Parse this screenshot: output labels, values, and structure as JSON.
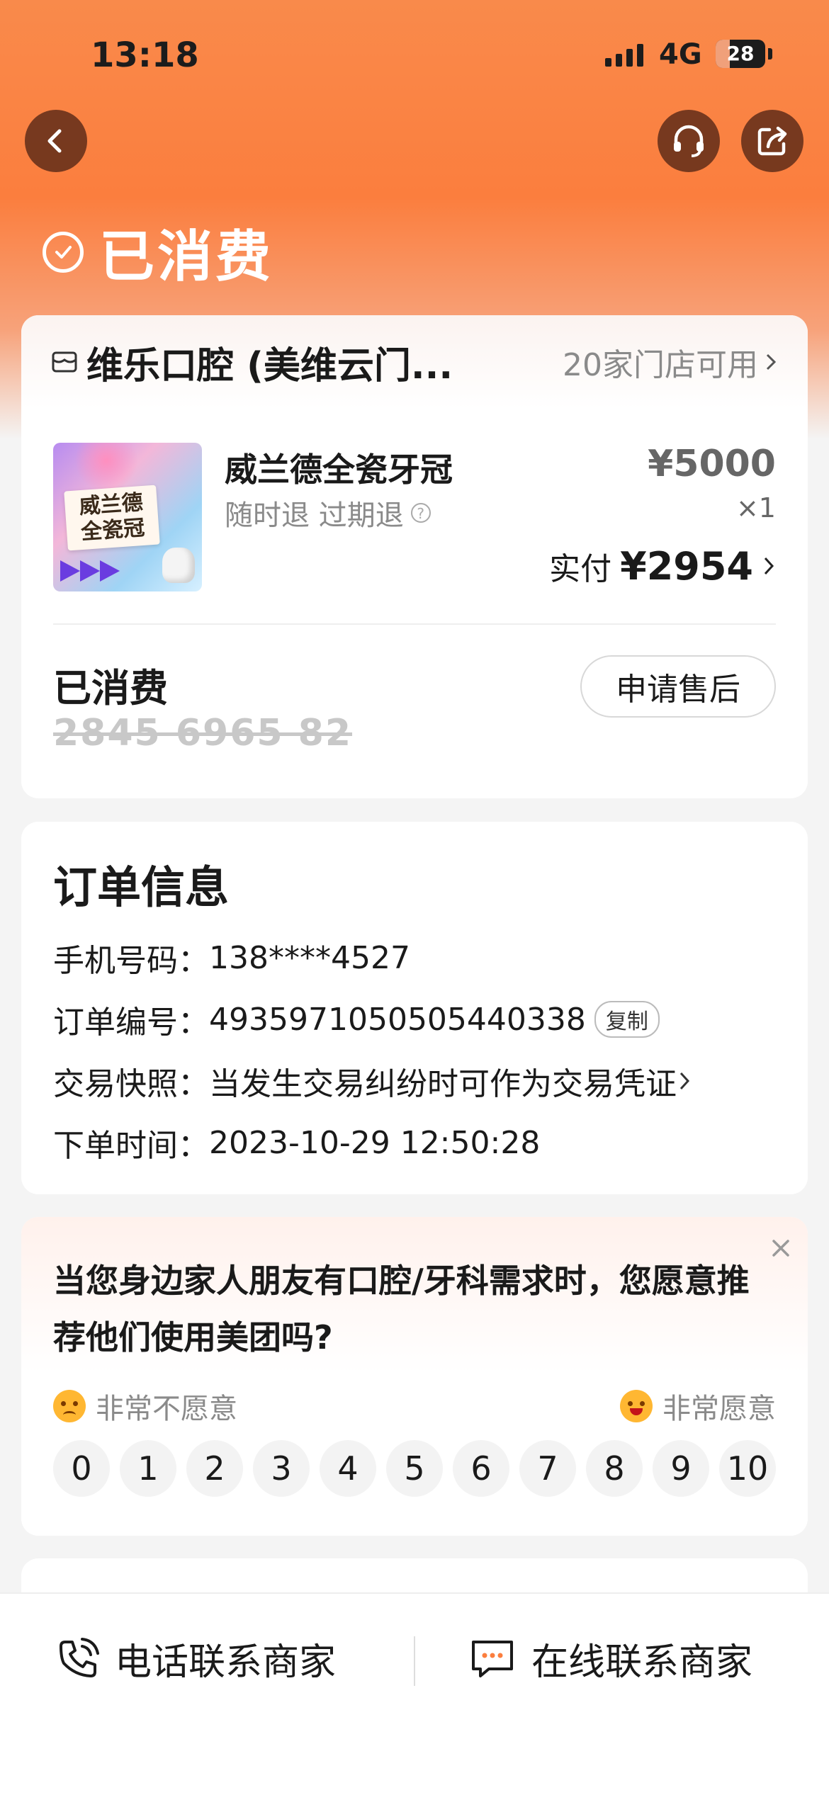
{
  "status_bar": {
    "time": "13:18",
    "network": "4G",
    "battery": "28",
    "battery_level": 0.28
  },
  "header": {
    "page_title": "已消费"
  },
  "order_card": {
    "shop_name": "维乐口腔 (美维云门...",
    "shop_availability": "20家门店可用",
    "product_image_text": [
      "威兰德",
      "全瓷冠"
    ],
    "product_name": "威兰德全瓷牙冠",
    "product_tags": "随时退 过期退",
    "original_price": "¥5000",
    "quantity": "×1",
    "paid_label": "实付",
    "paid_amount": "¥2954",
    "consumed_label": "已消费",
    "voucher_code": "2845 6965 82",
    "after_sale_label": "申请售后"
  },
  "order_info": {
    "title": "订单信息",
    "rows": [
      {
        "label": "手机号码：",
        "value": "138****4527"
      },
      {
        "label": "订单编号：",
        "value": "4935971050505440338",
        "action": "复制"
      },
      {
        "label": "交易快照：",
        "value": "当发生交易纠纷时可作为交易凭证"
      },
      {
        "label": "下单时间：",
        "value": "2023-10-29 12:50:28"
      }
    ]
  },
  "survey": {
    "question": "当您身边家人朋友有口腔/牙科需求时，您愿意推荐他们使用美团吗?",
    "low_label": "非常不愿意",
    "high_label": "非常愿意",
    "scores": [
      "0",
      "1",
      "2",
      "3",
      "4",
      "5",
      "6",
      "7",
      "8",
      "9",
      "10"
    ]
  },
  "bottom_bar": {
    "call_label": "电话联系商家",
    "chat_label": "在线联系商家"
  },
  "colors": {
    "header_orange": "#fb7e3e",
    "text_dark": "#1a1a1a",
    "text_gray": "#8a8a8a"
  },
  "icons": [
    "back-icon",
    "headset-icon",
    "share-icon",
    "check-circle-icon",
    "shop-icon",
    "chevron-right-icon",
    "question-icon",
    "close-icon",
    "sad-face-icon",
    "happy-face-icon",
    "phone-icon",
    "chat-icon"
  ]
}
